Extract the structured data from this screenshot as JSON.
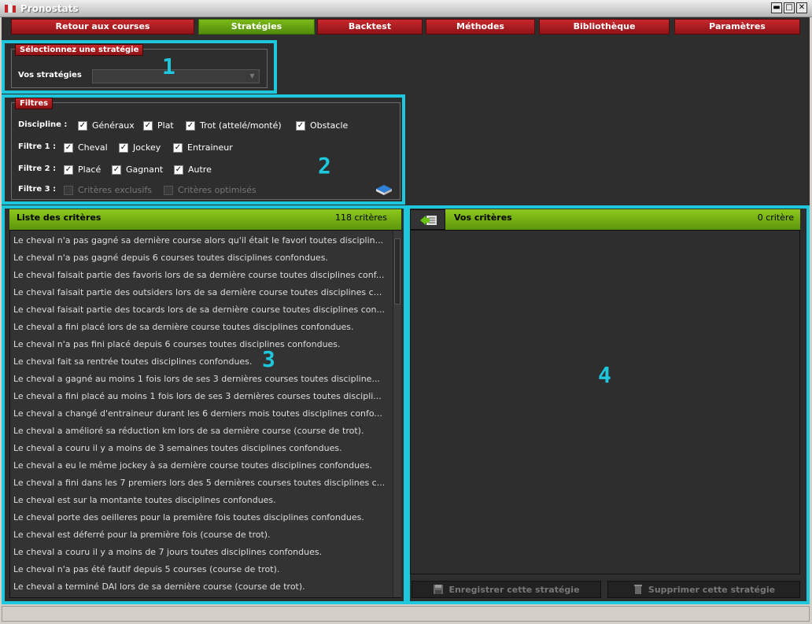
{
  "window": {
    "title": "Pronostats",
    "minimize": "▬",
    "maximize": "□",
    "close": "✕"
  },
  "nav": [
    {
      "label": "Retour aux courses",
      "active": false
    },
    {
      "label": "Stratégies",
      "active": true
    },
    {
      "label": "Backtest",
      "active": false
    },
    {
      "label": "Méthodes",
      "active": false
    },
    {
      "label": "Bibliothèque",
      "active": false
    },
    {
      "label": "Paramètres",
      "active": false
    }
  ],
  "strategy": {
    "legend": "Sélectionnez une stratégie",
    "label": "Vos stratégies",
    "value": ""
  },
  "filters": {
    "legend": "Filtres",
    "discipline": {
      "label": "Discipline :",
      "options": [
        "Généraux",
        "Plat",
        "Trot (attelé/monté)",
        "Obstacle"
      ]
    },
    "filtre1": {
      "label": "Filtre 1 :",
      "options": [
        "Cheval",
        "Jockey",
        "Entraineur"
      ]
    },
    "filtre2": {
      "label": "Filtre 2 :",
      "options": [
        "Placé",
        "Gagnant",
        "Autre"
      ]
    },
    "filtre3": {
      "label": "Filtre 3 :",
      "options": [
        "Critères exclusifs",
        "Critères optimisés"
      ]
    }
  },
  "markers": [
    "1",
    "2",
    "3",
    "4"
  ],
  "criteria_list": {
    "title": "Liste des critères",
    "count": "118 critères",
    "items": [
      "Le cheval n'a pas gagné sa dernière course alors qu'il était le favori toutes disciplin...",
      "Le cheval n'a pas gagné depuis 6 courses toutes disciplines confondues.",
      "Le cheval faisait partie des favoris lors de sa dernière course toutes disciplines conf...",
      "Le cheval faisait partie des outsiders lors de sa dernière course toutes disciplines c...",
      "Le cheval faisait partie des tocards lors de sa dernière course toutes disciplines con...",
      "Le cheval a fini placé lors de sa dernière course toutes disciplines confondues.",
      "Le cheval n'a pas fini placé depuis 6 courses toutes disciplines confondues.",
      "Le cheval fait sa rentrée toutes disciplines confondues.",
      "Le cheval a gagné au moins 1 fois lors de ses 3 dernières courses toutes discipline...",
      "Le cheval a fini placé au moins 1 fois lors de ses 3 dernières courses toutes discipli...",
      "Le cheval a changé d'entraineur durant les 6 derniers mois toutes disciplines confo...",
      "Le cheval a amélioré sa réduction km lors de sa dernière course (course de trot).",
      "Le cheval a couru il y a moins de 3 semaines toutes disciplines confondues.",
      "Le cheval a eu le même jockey à sa dernière course toutes disciplines confondues.",
      "Le cheval a fini dans les 7 premiers lors des 5 dernières courses toutes disciplines c...",
      "Le cheval est sur la montante toutes disciplines confondues.",
      "Le cheval porte des oeilleres pour la première fois toutes disciplines confondues.",
      "Le cheval est déferré pour la première fois (course de trot).",
      "Le cheval a couru il y a moins de 7 jours toutes disciplines confondues.",
      "Le cheval n'a pas été fautif depuis 5 courses (course de trot).",
      "Le cheval a terminé DAI lors de sa dernière course (course de trot)."
    ]
  },
  "my_criteria": {
    "title": "Vos critères",
    "count": "0 critère",
    "save_label": "Enregistrer cette stratégie",
    "delete_label": "Supprimer cette stratégie"
  },
  "colors": {
    "highlight": "#1ec8dc",
    "nav_red": "#b01e22",
    "nav_green": "#6aa812",
    "panel_green": "#7ab916"
  },
  "icons": [
    "app-icon",
    "book-icon",
    "back-arrow-icon",
    "disk-icon",
    "trash-icon"
  ]
}
